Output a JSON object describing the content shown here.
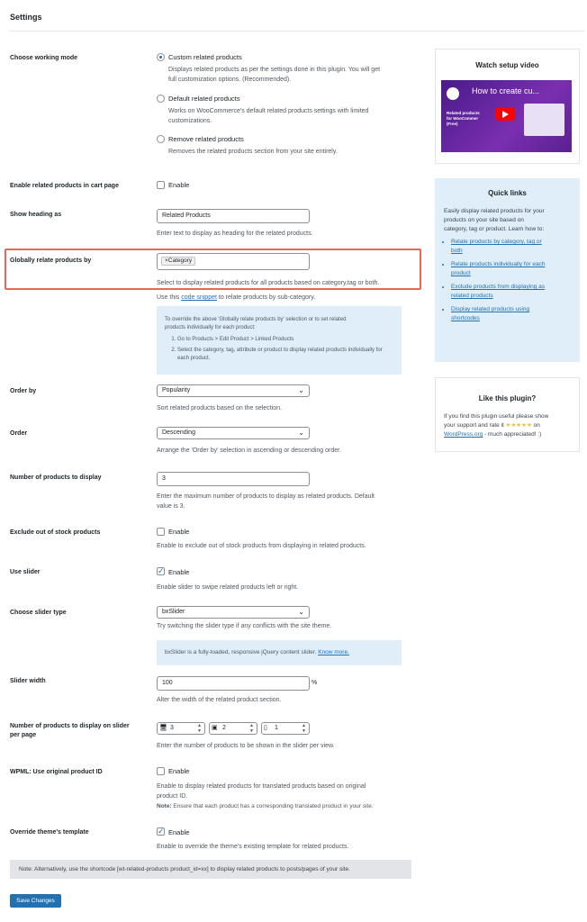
{
  "page": {
    "title": "Settings"
  },
  "working_mode": {
    "label": "Choose working mode",
    "options": [
      {
        "label": "Custom related products",
        "desc1": "Displays related products as per the settings done in this plugin. You will get",
        "desc2": "full customization options. (Recommended).",
        "checked": true
      },
      {
        "label": "Default related products",
        "desc1": "Works on WooCommerce's default related products settings with limited",
        "desc2": "customizations.",
        "checked": false
      },
      {
        "label": "Remove related products",
        "desc1": "Removes the related products section from your site entirely.",
        "desc2": "",
        "checked": false
      }
    ]
  },
  "cart_page": {
    "label": "Enable related products in cart page",
    "option": "Enable"
  },
  "heading": {
    "label": "Show heading as",
    "value": "Related Products",
    "desc": "Enter text to display as heading for the related products."
  },
  "globally": {
    "label": "Globally relate products by",
    "chip": "Category",
    "chip_x": "×",
    "desc": "Select to display related products for all products based on category,tag or both.",
    "snippet_pre": "Use this ",
    "snippet_link": "code snippet",
    "snippet_post": " to relate products by sub-category."
  },
  "override_info": {
    "intro1": "To override the above 'Globally relate products by' selection or to set related",
    "intro2": "products individually for each product:",
    "steps": [
      "Go to Products > Edit Product > Linked Products",
      "Select the category, tag, attribute or product to display related products individually for each product."
    ]
  },
  "order_by": {
    "label": "Order by",
    "value": "Popularity",
    "desc": "Sort related products based on the selection."
  },
  "order": {
    "label": "Order",
    "value": "Descending",
    "desc": "Arrange the 'Order by' selection in ascending or descending order."
  },
  "num_products": {
    "label": "Number of products to display",
    "value": "3",
    "desc1": "Enter the maximum number of products to display as related products. Default",
    "desc2": "value is 3."
  },
  "exclude_stock": {
    "label": "Exclude out of stock products",
    "option": "Enable",
    "desc": "Enable to exclude out of stock products from displaying in related products."
  },
  "use_slider": {
    "label": "Use slider",
    "option": "Enable",
    "desc": "Enable slider to swipe related products left or right."
  },
  "slider_type": {
    "label": "Choose slider type",
    "value": "bxSlider",
    "desc": "Try switching the slider type if any conflicts with the site theme.",
    "info": "bxSlider is a fully-loaded, responsive jQuery content slider.",
    "info_link": "Know more."
  },
  "slider_width": {
    "label": "Slider width",
    "value": "100",
    "unit": "%",
    "desc": "Alter the width of the related product section."
  },
  "per_page": {
    "label1": "Number of products to display on slider",
    "label2": "per page",
    "desktop": "3",
    "tablet": "2",
    "mobile": "1",
    "desc": "Enter the number of products to be shown in the slider per view."
  },
  "wpml": {
    "label": "WPML: Use original product ID",
    "option": "Enable",
    "desc1": "Enable to display related products for translated products based on original",
    "desc2": "product ID.",
    "note_bold": "Note:",
    "note": " Ensure that each product has a corresponding translated product in your site."
  },
  "override_template": {
    "label": "Override theme's template",
    "option": "Enable",
    "desc": "Enable to override the theme's existing template for related products."
  },
  "footer_note": "Note: Alternatively, use the shortcode [wt-related-products product_id=xx] to display related products to posts/pages of your site.",
  "save_label": "Save Changes",
  "sidebar": {
    "video": {
      "title": "Watch setup video",
      "thumb_title": "How to create cu...",
      "thumb_sub1": "Related products",
      "thumb_sub2": "for WooCommer",
      "thumb_sub3": "(Free)"
    },
    "quick_links": {
      "title": "Quick links",
      "intro1": "Easily display related products for your",
      "intro2": "products on your site based on",
      "intro3": "category, tag or product. Learn how to:",
      "items": [
        {
          "line1": "Relate products by category, tag or",
          "line2": "both"
        },
        {
          "line1": "Relate products individually for each",
          "line2": "product"
        },
        {
          "line1": "Exclude products from displaying as",
          "line2": "related products"
        },
        {
          "line1": "Display related products using",
          "line2": "shortcodes"
        }
      ]
    },
    "like": {
      "title": "Like this plugin?",
      "line1": "If you find this plugin useful please show",
      "line2_pre": "your support and rate it ",
      "stars": "★★★★★",
      "line2_post": " on",
      "link": "WordPress.org",
      "line3_post": " - much appreciated! :)"
    }
  },
  "colors": {
    "accent": "#2271b1",
    "highlight": "#e26a5b",
    "info_bg": "#dfeef8",
    "star": "#f0b849"
  }
}
